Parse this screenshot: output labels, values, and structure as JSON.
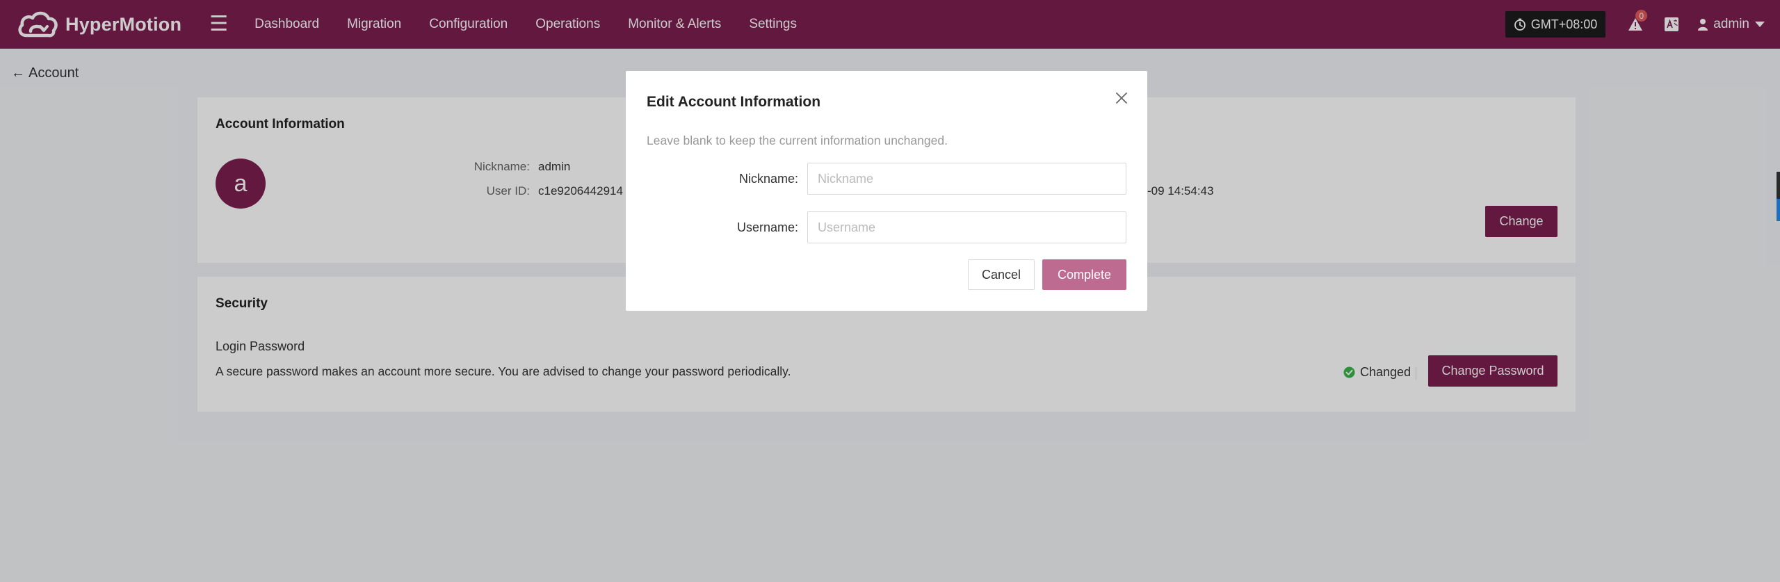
{
  "app": {
    "name": "HyperMotion"
  },
  "nav": {
    "items": [
      "Dashboard",
      "Migration",
      "Configuration",
      "Operations",
      "Monitor & Alerts",
      "Settings"
    ]
  },
  "header": {
    "timezone": "GMT+08:00",
    "alert_count": "0",
    "user": "admin"
  },
  "page": {
    "back_label": "Account"
  },
  "account_card": {
    "title": "Account Information",
    "avatar_letter": "a",
    "nickname_label": "Nickname:",
    "nickname_value": "admin",
    "userid_label": "User ID:",
    "userid_value": "c1e9206442914",
    "time_value": "-09 14:54:43",
    "change_label": "Change"
  },
  "security_card": {
    "title": "Security",
    "login_title": "Login Password",
    "login_desc": "A secure password makes an account more secure. You are advised to change your password periodically.",
    "status": "Changed",
    "status_color": "#3bb54a",
    "change_password_label": "Change Password"
  },
  "modal": {
    "title": "Edit Account Information",
    "hint": "Leave blank to keep the current information unchanged.",
    "nickname_label": "Nickname:",
    "nickname_placeholder": "Nickname",
    "username_label": "Username:",
    "username_placeholder": "Username",
    "cancel_label": "Cancel",
    "complete_label": "Complete"
  },
  "colors": {
    "brand": "#7b1f4f",
    "complete_disabled": "#bd6b90"
  }
}
